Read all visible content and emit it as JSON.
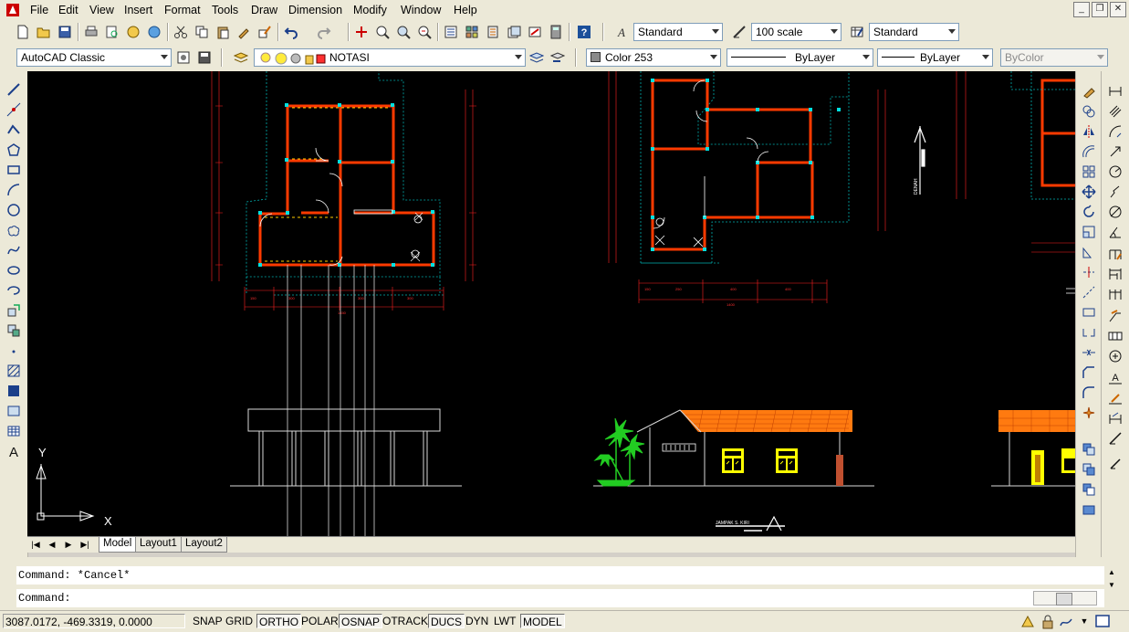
{
  "menubar": {
    "items": [
      "File",
      "Edit",
      "View",
      "Insert",
      "Format",
      "Tools",
      "Draw",
      "Dimension",
      "Modify",
      "Window",
      "Help"
    ]
  },
  "toolbar": {
    "text_style": "Standard",
    "dim_style": "100 scale",
    "table_style": "Standard"
  },
  "properties": {
    "workspace": "AutoCAD Classic",
    "layer": "NOTASI",
    "color": "Color 253",
    "linetype": "ByLayer",
    "lineweight": "ByLayer",
    "plotstyle": "ByColor"
  },
  "drawing": {
    "view_label": "JAMPAK S. KIRI",
    "north_label": "DENAH",
    "ucs_x": "X",
    "ucs_y": "Y",
    "colors": {
      "background": "#000000",
      "wall": "#ff3300",
      "dimension": "#ff2020",
      "grid": "#00c0c0",
      "roof": "#ff6a00",
      "window": "#ffff00",
      "tree": "#22cc22"
    }
  },
  "tabs": [
    "Model",
    "Layout1",
    "Layout2"
  ],
  "command": {
    "history": "Command: *Cancel*",
    "prompt": "Command:"
  },
  "status": {
    "coordinates": "3087.0172, -469.3319, 0.0000",
    "buttons": [
      "SNAP",
      "GRID",
      "ORTHO",
      "POLAR",
      "OSNAP",
      "OTRACK",
      "DUCS",
      "DYN",
      "LWT",
      "MODEL"
    ],
    "on": [
      "ORTHO",
      "OSNAP",
      "DUCS",
      "MODEL"
    ]
  }
}
